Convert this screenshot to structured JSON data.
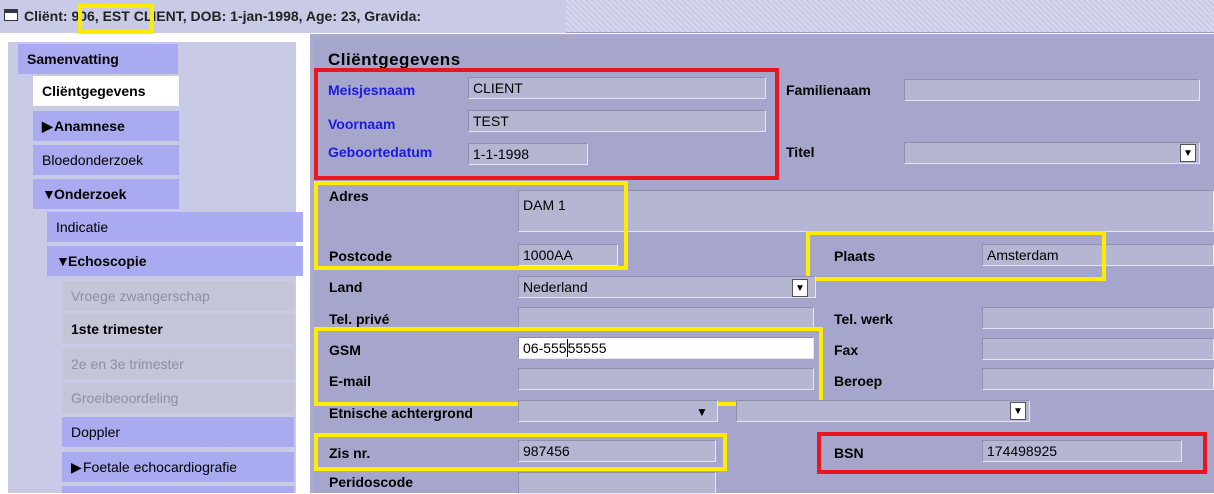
{
  "window": {
    "title_prefix": "Cliënt:",
    "client_number": "906,",
    "title_rest": "EST CLIENT, DOB: 1-jan-1998, Age: 23, Gravida:"
  },
  "sidebar": {
    "items": [
      {
        "label": "Samenvatting"
      },
      {
        "label": "Cliëntgegevens"
      },
      {
        "label": "Anamnese"
      },
      {
        "label": "Bloedonderzoek"
      },
      {
        "label": "Onderzoek"
      },
      {
        "label": "Indicatie"
      },
      {
        "label": "Echoscopie"
      },
      {
        "label": "Vroege zwangerschap"
      },
      {
        "label": "1ste trimester"
      },
      {
        "label": "2e en 3e trimester"
      },
      {
        "label": "Groeibeoordeling"
      },
      {
        "label": "Doppler"
      },
      {
        "label": "Foetale echocardiografie"
      }
    ]
  },
  "form": {
    "title": "Cliëntgegevens",
    "meisjesnaam": {
      "label": "Meisjesnaam",
      "value": "CLIENT"
    },
    "voornaam": {
      "label": "Voornaam",
      "value": "TEST"
    },
    "geboortedatum": {
      "label": "Geboortedatum",
      "value": "1-1-1998"
    },
    "familienaam": {
      "label": "Familienaam",
      "value": ""
    },
    "titel": {
      "label": "Titel",
      "value": ""
    },
    "adres": {
      "label": "Adres",
      "value": "DAM 1"
    },
    "postcode": {
      "label": "Postcode",
      "value": "1000AA"
    },
    "plaats": {
      "label": "Plaats",
      "value": "Amsterdam"
    },
    "land": {
      "label": "Land",
      "value": "Nederland"
    },
    "tel_prive": {
      "label": "Tel. privé",
      "value": ""
    },
    "tel_werk": {
      "label": "Tel. werk",
      "value": ""
    },
    "gsm": {
      "label": "GSM",
      "value_before_caret": "06-555",
      "value_after_caret": "55555"
    },
    "fax": {
      "label": "Fax",
      "value": ""
    },
    "email": {
      "label": "E-mail",
      "value": ""
    },
    "beroep": {
      "label": "Beroep",
      "value": ""
    },
    "etnische": {
      "label": "Etnische achtergrond",
      "value1": "",
      "value2": ""
    },
    "zis": {
      "label": "Zis nr.",
      "value": "987456"
    },
    "bsn": {
      "label": "BSN",
      "value": "174498925"
    },
    "peridoscode": {
      "label": "Peridoscode",
      "value": ""
    }
  },
  "colors": {
    "highlight_yellow": "#ffec00",
    "highlight_red": "#e8161e",
    "panel": "#a6a6cc",
    "nav_item": "#aaaaf0",
    "label_blue": "#1a1ae0"
  }
}
